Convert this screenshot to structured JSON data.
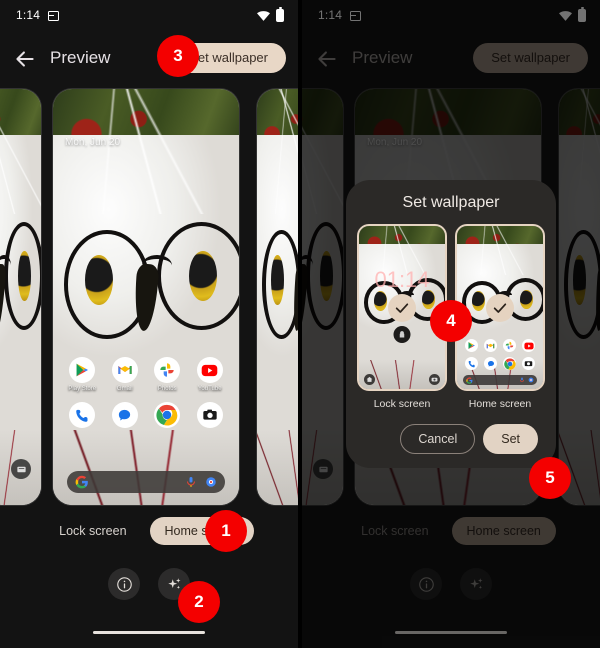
{
  "status_bar": {
    "time": "1:14",
    "icons": [
      "notification-icon",
      "wifi-icon",
      "battery-icon"
    ]
  },
  "app_bar": {
    "back_label": "back-arrow-icon",
    "title": "Preview",
    "set_wallpaper_label": "Set wallpaper"
  },
  "preview": {
    "lock_date": "Mon, Jun 20",
    "home_apps_row1": [
      {
        "label": "Play Store",
        "icon": "play-store-icon"
      },
      {
        "label": "Gmail",
        "icon": "gmail-icon"
      },
      {
        "label": "Photos",
        "icon": "google-photos-icon"
      },
      {
        "label": "YouTube",
        "icon": "youtube-icon"
      }
    ],
    "home_apps_dock": [
      {
        "label": "Phone",
        "icon": "phone-icon"
      },
      {
        "label": "Messages",
        "icon": "messages-icon"
      },
      {
        "label": "Chrome",
        "icon": "chrome-icon"
      },
      {
        "label": "Camera",
        "icon": "camera-icon"
      }
    ],
    "search_icons": [
      "google-g-icon",
      "microphone-icon",
      "google-lens-icon"
    ]
  },
  "bottom_controls": {
    "chips": [
      {
        "label": "Lock screen",
        "selected": false
      },
      {
        "label": "Home screen",
        "selected": true
      }
    ],
    "actions": [
      {
        "name": "info-button",
        "icon": "info-icon"
      },
      {
        "name": "effects-button",
        "icon": "sparkle-icon"
      }
    ]
  },
  "dialog": {
    "title": "Set wallpaper",
    "options": [
      {
        "label": "Lock screen",
        "selected": true,
        "clock": "01:14"
      },
      {
        "label": "Home screen",
        "selected": true
      }
    ],
    "cancel_label": "Cancel",
    "set_label": "Set"
  },
  "badges": [
    {
      "number": "1",
      "target": "home-screen-chip"
    },
    {
      "number": "2",
      "target": "effects-button"
    },
    {
      "number": "3",
      "target": "set-wallpaper-button"
    },
    {
      "number": "4",
      "target": "wallpaper-destination-thumbnails"
    },
    {
      "number": "5",
      "target": "set-button"
    }
  ],
  "colors": {
    "accent_button": "#e2d3c4",
    "badge_red": "#f40000",
    "surface": "#2b2927",
    "background": "#131313"
  }
}
